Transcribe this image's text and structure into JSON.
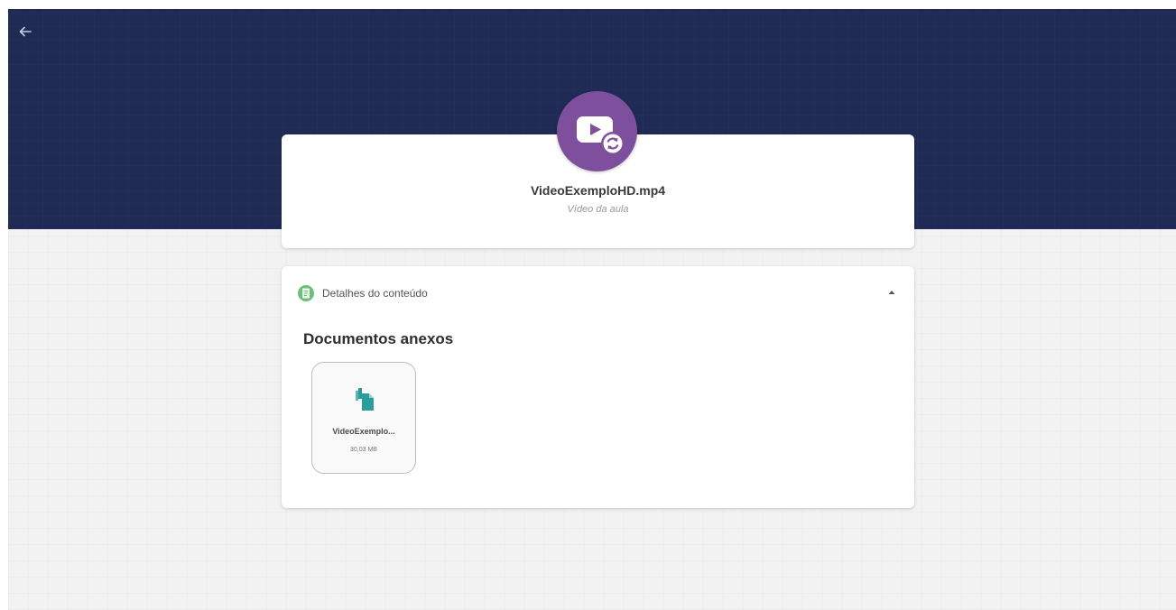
{
  "header": {
    "back_icon": "arrow-left-icon",
    "bg_color": "#1f2b55"
  },
  "media": {
    "icon": "video-sync-icon",
    "color": "#7e4f9d",
    "title": "VideoExemploHD.mp4",
    "subtitle": "Vídeo da aula"
  },
  "details": {
    "icon": "document-icon",
    "icon_color": "#6cc07a",
    "label": "Detalhes do conteúdo",
    "toggle_icon": "caret-up-icon",
    "section_title": "Documentos anexos",
    "attachments": [
      {
        "icon": "file-icon",
        "icon_color": "#2a9d9c",
        "name": "VideoExemplo...",
        "size": "30,03 MB"
      }
    ]
  }
}
